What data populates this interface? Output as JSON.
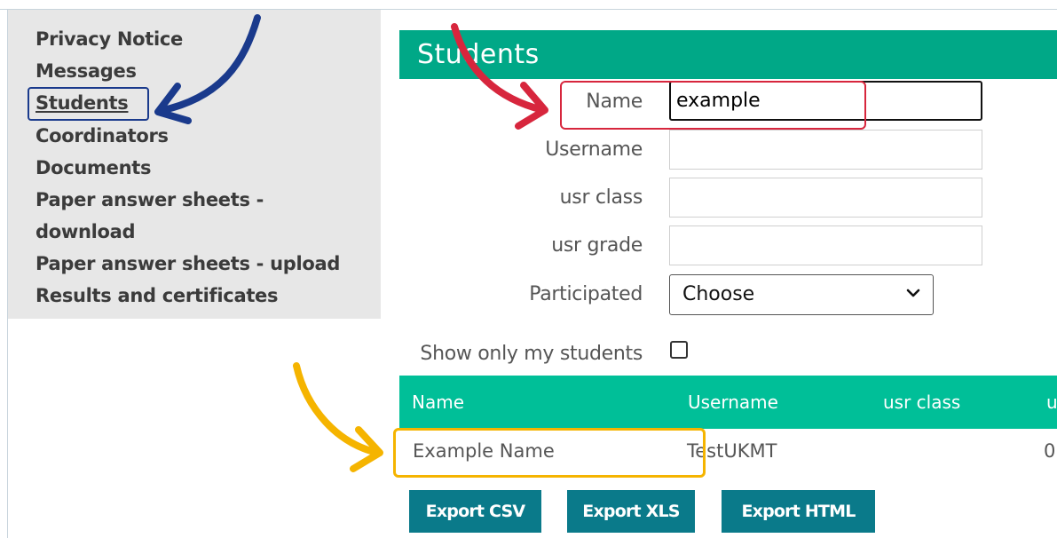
{
  "sidebar": {
    "items": [
      {
        "label": "Privacy Notice"
      },
      {
        "label": "Messages"
      },
      {
        "label": "Students"
      },
      {
        "label": "Coordinators"
      },
      {
        "label": "Documents"
      },
      {
        "label": "Paper answer sheets -"
      },
      {
        "label": "download"
      },
      {
        "label": "Paper answer sheets - upload"
      },
      {
        "label": "Results and certificates"
      }
    ],
    "active": "Students"
  },
  "header": {
    "title": "Students"
  },
  "form": {
    "name_label": "Name",
    "name_value": "example",
    "username_label": "Username",
    "username_value": "",
    "class_label": "usr class",
    "class_value": "",
    "grade_label": "usr grade",
    "grade_value": "",
    "participated_label": "Participated",
    "participated_selected": "Choose",
    "show_mine_label": "Show only my students",
    "show_mine_checked": false
  },
  "table": {
    "headers": [
      "Name",
      "Username",
      "usr class",
      "u"
    ],
    "rows": [
      [
        "Example Name",
        "TestUKMT",
        "",
        "0"
      ]
    ]
  },
  "buttons": {
    "export_csv": "Export CSV",
    "export_xls": "Export XLS",
    "export_html": "Export HTML"
  },
  "colors": {
    "header_green": "#00a887",
    "table_header": "#00bf98",
    "button_teal": "#0a7a8a",
    "annotation_blue": "#1a3a8c",
    "annotation_red": "#d7263d",
    "annotation_yellow": "#f5b400"
  }
}
